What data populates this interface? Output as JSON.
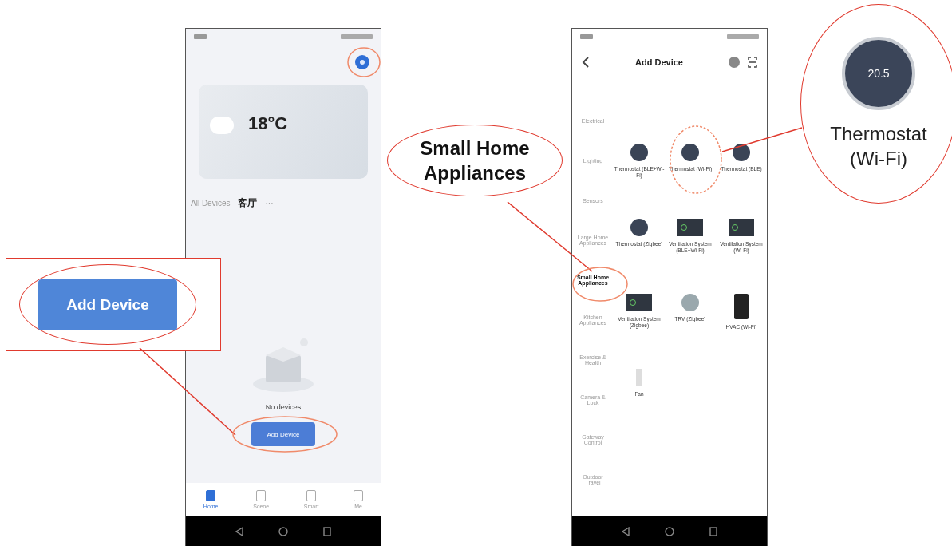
{
  "callout_button": {
    "label": "Add Device"
  },
  "home_screen": {
    "temperature": "18°C",
    "tabs": [
      {
        "label": "All Devices",
        "selected": false
      },
      {
        "label": "客厅",
        "selected": true
      }
    ],
    "more": "···",
    "empty_text": "No devices",
    "add_button": "Add Device",
    "nav": [
      {
        "label": "Home",
        "selected": true
      },
      {
        "label": "Scene",
        "selected": false
      },
      {
        "label": "Smart",
        "selected": false
      },
      {
        "label": "Me",
        "selected": false
      }
    ]
  },
  "add_screen": {
    "title": "Add Device",
    "categories": [
      {
        "label": "Electrical",
        "selected": false
      },
      {
        "label": "Lighting",
        "selected": false
      },
      {
        "label": "Sensors",
        "selected": false
      },
      {
        "label": "Large Home Appliances",
        "selected": false
      },
      {
        "label": "Small Home Appliances",
        "selected": true
      },
      {
        "label": "Kitchen Appliances",
        "selected": false
      },
      {
        "label": "Exercise & Health",
        "selected": false
      },
      {
        "label": "Camera & Lock",
        "selected": false
      },
      {
        "label": "Gateway Control",
        "selected": false
      },
      {
        "label": "Outdoor Travel",
        "selected": false
      }
    ],
    "devices": [
      {
        "kind": "round",
        "label": "Thermostat (BLE+Wi-Fi)"
      },
      {
        "kind": "round",
        "label": "Thermostat (Wi-Fi)"
      },
      {
        "kind": "round",
        "label": "Thermostat (BLE)"
      },
      {
        "kind": "round",
        "label": "Thermostat (Zigbee)"
      },
      {
        "kind": "panel",
        "label": "Ventilation System (BLE+Wi-Fi)"
      },
      {
        "kind": "panel",
        "label": "Ventilation System (Wi-Fi)"
      },
      {
        "kind": "panel",
        "label": "Ventilation System (Zigbee)"
      },
      {
        "kind": "disc",
        "label": "TRV (Zigbee)"
      },
      {
        "kind": "tall",
        "label": "HVAC (Wi-Fi)"
      },
      {
        "kind": "small",
        "label": "Fan"
      }
    ]
  },
  "callout_category": {
    "label": "Small Home Appliances"
  },
  "callout_device": {
    "reading": "20.5",
    "label": "Thermostat (Wi-Fi)"
  }
}
